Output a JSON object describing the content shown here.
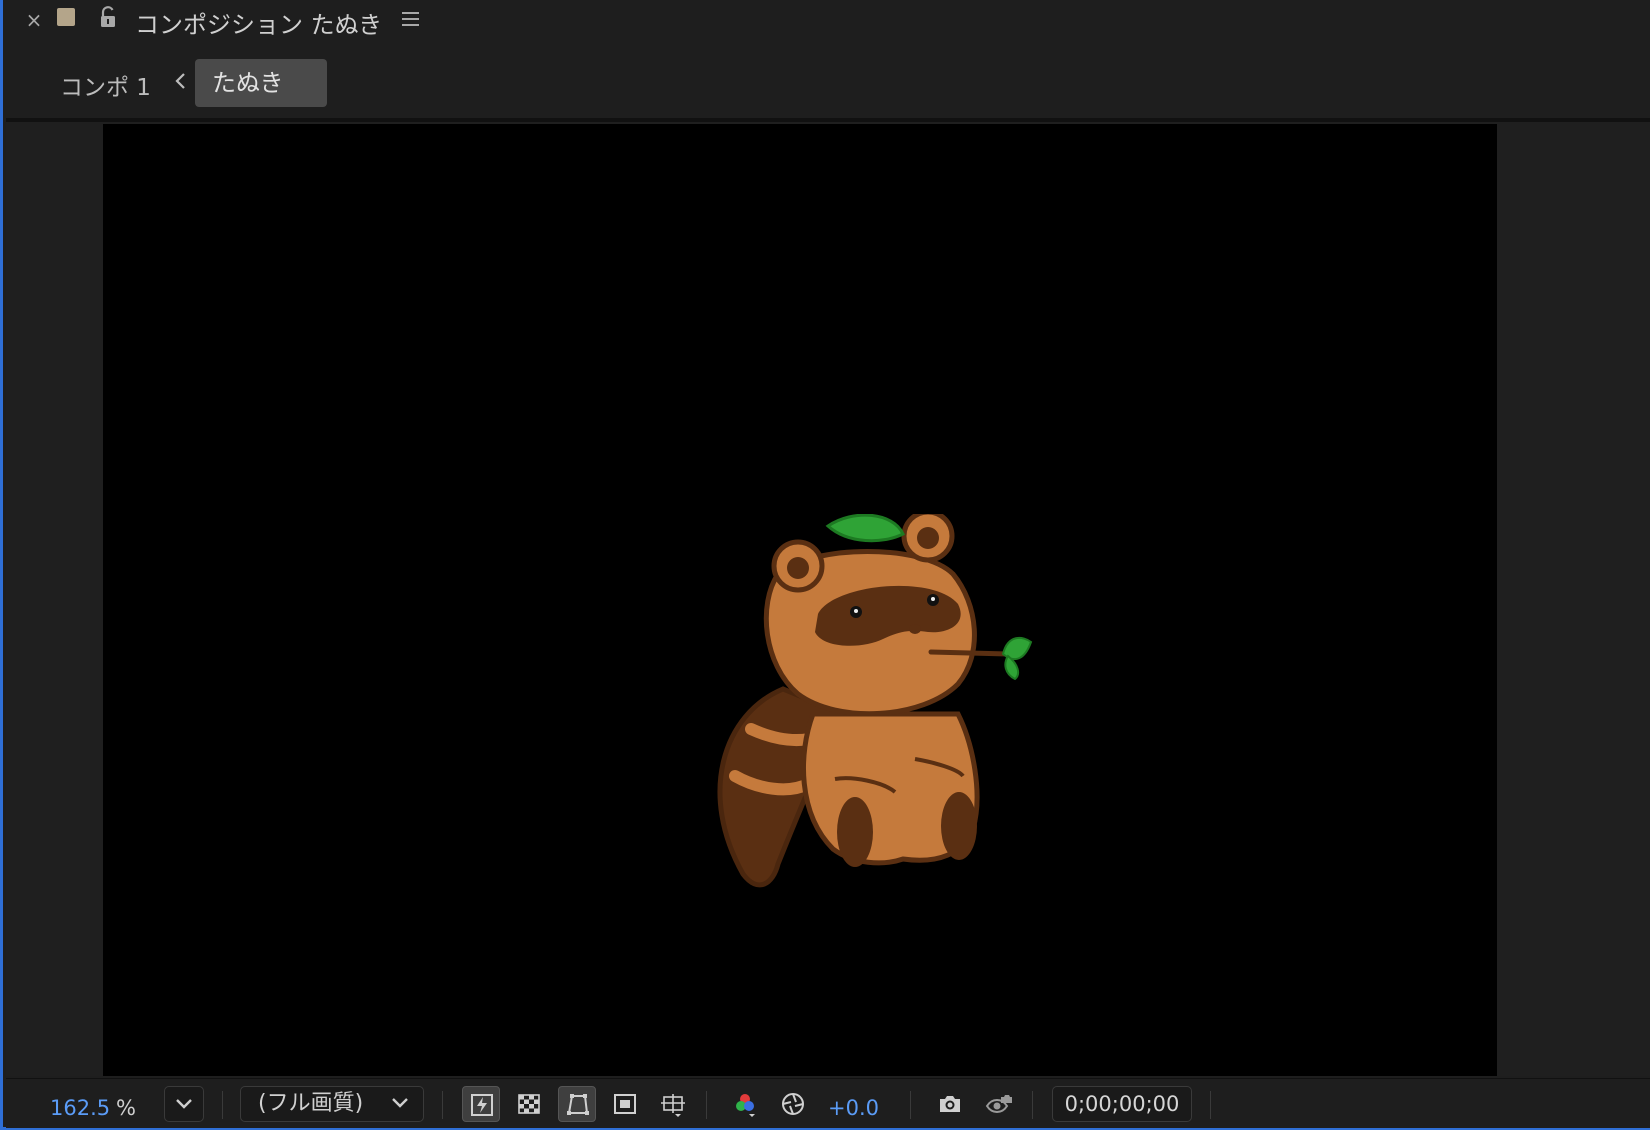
{
  "panel": {
    "title": "コンポジション たぬき",
    "label_color": "#b4a58a",
    "icons": [
      "close-icon",
      "lock-icon",
      "panel-menu-icon"
    ]
  },
  "breadcrumb": {
    "items": [
      {
        "label": "コンポ 1",
        "active": false
      },
      {
        "label": "たぬき",
        "active": true
      }
    ]
  },
  "toolbar": {
    "zoom_value": "162.5",
    "zoom_unit": "%",
    "resolution": "(フル画質)",
    "exposure": "+0.0",
    "timecode": "0;00;00;00",
    "icons": [
      "fast-previews-icon",
      "transparency-grid-icon",
      "mask-path-icon",
      "region-of-interest-icon",
      "guides-grid-icon",
      "channel-rgb-icon",
      "reset-exposure-icon",
      "snapshot-icon",
      "show-snapshot-icon"
    ],
    "accent_color": "#5b9cf7"
  },
  "canvas": {
    "background": "#000000",
    "content": "tanuki-illustration"
  }
}
